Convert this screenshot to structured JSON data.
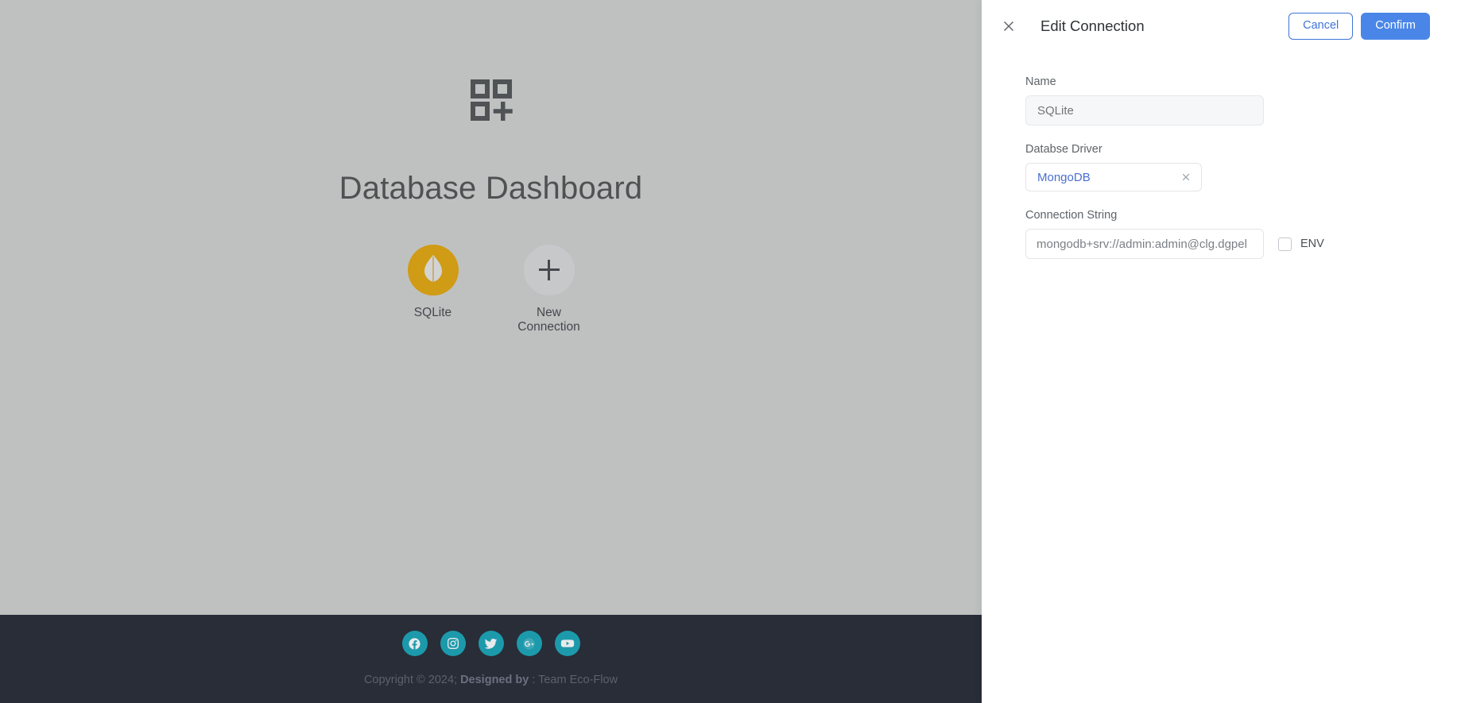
{
  "colors": {
    "backdrop": "#bfc1c1",
    "footer_bg": "#282d38",
    "social_bg": "#1c9aab",
    "db_circle": "#d09b15",
    "new_circle": "#c7c8ca",
    "accent_blue": "#4a86e8",
    "cancel_blue": "#3f74d8",
    "select_text_blue": "#4a6fd0"
  },
  "dashboard": {
    "icon": "grid-add-icon",
    "title": "Database Dashboard",
    "connections": [
      {
        "label": "SQLite",
        "icon": "mongodb-leaf-icon",
        "type": "database"
      },
      {
        "label": "New Connection",
        "icon": "plus-icon",
        "type": "new"
      }
    ]
  },
  "footer": {
    "social": [
      {
        "name": "facebook-icon",
        "label": "Facebook"
      },
      {
        "name": "instagram-icon",
        "label": "Instagram"
      },
      {
        "name": "twitter-icon",
        "label": "Twitter"
      },
      {
        "name": "google-plus-icon",
        "label": "Google Plus"
      },
      {
        "name": "youtube-icon",
        "label": "YouTube"
      }
    ],
    "copyright_prefix": "Copyright © 2024; ",
    "copyright_bold": "Designed by",
    "copyright_suffix": " : Team Eco-Flow"
  },
  "drawer": {
    "close_icon": "close-icon",
    "title": "Edit Connection",
    "cancel_label": "Cancel",
    "confirm_label": "Confirm",
    "fields": {
      "name": {
        "label": "Name",
        "value": "",
        "placeholder": "SQLite"
      },
      "driver": {
        "label": "Databse Driver",
        "value": "MongoDB",
        "clear_icon": "close-icon"
      },
      "connection_string": {
        "label": "Connection String",
        "value": "mongodb+srv://admin:admin@clg.dgpel",
        "env_label": "ENV",
        "env_checked": false
      }
    }
  }
}
